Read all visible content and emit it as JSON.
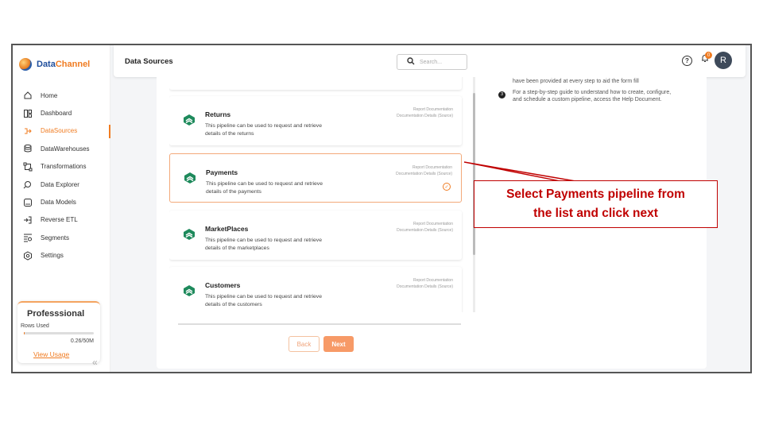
{
  "brand": {
    "name_part1": "Data",
    "name_part2": "Channel"
  },
  "sidebar": {
    "items": [
      {
        "label": "Home",
        "icon": "home-icon"
      },
      {
        "label": "Dashboard",
        "icon": "dashboard-icon"
      },
      {
        "label": "DataSources",
        "icon": "datasources-icon",
        "active": true
      },
      {
        "label": "DataWarehouses",
        "icon": "database-icon"
      },
      {
        "label": "Transformations",
        "icon": "transform-icon"
      },
      {
        "label": "Data Explorer",
        "icon": "explorer-icon"
      },
      {
        "label": "Data Models",
        "icon": "model-icon"
      },
      {
        "label": "Reverse ETL",
        "icon": "reverse-etl-icon"
      },
      {
        "label": "Segments",
        "icon": "segments-icon"
      },
      {
        "label": "Settings",
        "icon": "settings-icon"
      }
    ],
    "plan": {
      "title": "Professsional",
      "rows_label": "Rows Used",
      "usage": "0.26/50M",
      "usage_fraction": 0.005,
      "link": "View Usage"
    },
    "collapse_glyph": "«"
  },
  "header": {
    "title": "Data Sources",
    "search_placeholder": "Search...",
    "notification_count": "0",
    "avatar_initial": "R"
  },
  "pipelines": [
    {
      "name": "Returns",
      "description": "This pipeline can be used to request and retrieve details of the returns",
      "doc_link": "Report Documentation",
      "doc_details": "Documentation Details (Source)"
    },
    {
      "name": "Payments",
      "description": "This pipeline can be used to request and retrieve details of the payments",
      "doc_link": "Report Documentation",
      "doc_details": "Documentation Details (Source)",
      "selected": true
    },
    {
      "name": "MarketPlaces",
      "description": "This pipeline can be used to request and retrieve details of the marketplaces",
      "doc_link": "Report Documentation",
      "doc_details": "Documentation Details (Source)"
    },
    {
      "name": "Customers",
      "description": "This pipeline can be used to request and retrieve details of the customers",
      "doc_link": "Report Documentation",
      "doc_details": "Documentation Details (Source)"
    }
  ],
  "buttons": {
    "back": "Back",
    "next": "Next"
  },
  "info": {
    "line_partial": "have been provided at every step to aid the form fill",
    "step_number": "3",
    "step_text": "For a step-by-step guide to understand how to create, configure, and schedule a custom pipeline, access the Help Document."
  },
  "callout": {
    "line1": "Select Payments pipeline from",
    "line2": "the list and click next"
  },
  "colors": {
    "accent": "#f07c22",
    "callout": "#c00000",
    "brand_blue": "#1f4e9c"
  }
}
